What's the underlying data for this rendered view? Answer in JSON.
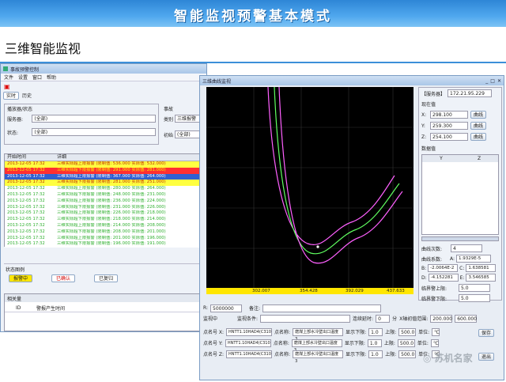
{
  "banner": {
    "title": "智能监视预警基本模式"
  },
  "slide": {
    "title": "三维智能监视"
  },
  "left_window": {
    "title": "事故预警控制",
    "menu": [
      "文件",
      "设置",
      "窗口",
      "帮助"
    ],
    "tabs": [
      "实时",
      "历史"
    ],
    "filter_section": "播放器/状态",
    "server_label": "服务器:",
    "server_value": "(全部)",
    "status_label": "状态:",
    "status_value": "(全部)",
    "right_labels": [
      "事故",
      "类别",
      "初始"
    ],
    "right_values": [
      "三维报警",
      "(全部)"
    ],
    "table": {
      "headers": [
        "开始时间",
        "详细"
      ],
      "rows": [
        {
          "time": "2013-12-05 17:32",
          "detail": "三维实际超上限报警 (限制值: 536.000  实际值: 532.000)",
          "color": "#ffff40",
          "text": "#c03000"
        },
        {
          "time": "2013-12-05 17:32",
          "detail": "三维实际超下限报警 (限制值: 291.000  实际值: 281.000)",
          "color": "#ff3030",
          "text": "#ffee00"
        },
        {
          "time": "2013-12-05 17:32",
          "detail": "三维实际超上限报警 (限制值: 367.000  实际值: 264.000)",
          "color": "#3060d0",
          "text": "#ffffff"
        },
        {
          "time": "2013-12-05 17:32",
          "detail": "三维实际超下限报警 (限制值: 281.000  实际值: 251.000)",
          "color": "#ffff40",
          "text": "#c03000"
        },
        {
          "time": "2013-12-05 17:32",
          "detail": "三维实际超上限报警 (限制值: 280.000  实际值: 264.000)",
          "color": "#ffffff",
          "text": "#30b030"
        },
        {
          "time": "2013-12-05 17:32",
          "detail": "三维实际超下限报警 (限制值: 248.000  实际值: 231.000)",
          "color": "#ffffff",
          "text": "#30b030"
        },
        {
          "time": "2013-12-05 17:32",
          "detail": "三维实际超上限报警 (限制值: 236.000  实际值: 224.000)",
          "color": "#ffffff",
          "text": "#30b030"
        },
        {
          "time": "2013-12-05 17:32",
          "detail": "三维实际超下限报警 (限制值: 231.000  实际值: 226.000)",
          "color": "#ffffff",
          "text": "#30b030"
        },
        {
          "time": "2013-12-05 17:32",
          "detail": "三维实际超上限报警 (限制值: 226.000  实际值: 218.000)",
          "color": "#ffffff",
          "text": "#30b030"
        },
        {
          "time": "2013-12-05 17:32",
          "detail": "三维实际超下限报警 (限制值: 218.000  实际值: 214.000)",
          "color": "#ffffff",
          "text": "#30b030"
        },
        {
          "time": "2013-12-05 17:32",
          "detail": "三维实际超上限报警 (限制值: 214.000  实际值: 208.000)",
          "color": "#ffffff",
          "text": "#30b030"
        },
        {
          "time": "2013-12-05 17:32",
          "detail": "三维实际超下限报警 (限制值: 208.000  实际值: 201.000)",
          "color": "#ffffff",
          "text": "#30b030"
        },
        {
          "time": "2013-12-05 17:32",
          "detail": "三维实际超上限报警 (限制值: 201.000  实际值: 196.000)",
          "color": "#ffffff",
          "text": "#30b030"
        },
        {
          "time": "2013-12-05 17:32",
          "detail": "三维实际超下限报警 (限制值: 196.000  实际值: 191.000)",
          "color": "#ffffff",
          "text": "#30b030"
        }
      ]
    },
    "state_section": "状态图例",
    "state_buttons": [
      {
        "label": "报警中",
        "bg": "#ffe600",
        "fg": "#222"
      },
      {
        "label": "已确认",
        "bg": "#ffffff",
        "fg": "#d00000"
      },
      {
        "label": "已复归",
        "bg": "#ffffff",
        "fg": "#222"
      }
    ],
    "bottom_tab": "相关量",
    "bottom_col1": "ID",
    "bottom_col2": "警报产生时间"
  },
  "right_window": {
    "title": "三维曲线监视",
    "ruler_labels": [
      "302.007",
      "354.428",
      "392.029",
      "437.633"
    ],
    "side": {
      "server_label": "【服务器】",
      "server_value": "172.21.95.229",
      "current_label": "现在值",
      "rows": [
        {
          "label": "X:",
          "value": "298.100",
          "button": "曲线"
        },
        {
          "label": "Y:",
          "value": "259.300",
          "button": "曲线"
        },
        {
          "label": "Z:",
          "value": "254.100",
          "button": "曲线"
        }
      ],
      "table_label": "数据值",
      "table_cols": [
        "Y",
        "Z"
      ],
      "fit_rows": [
        {
          "label": "曲线次数:",
          "value": "4"
        },
        {
          "label": "曲线系数:",
          "a": "A:",
          "av": "1.9329E-5"
        },
        {
          "b": "B:",
          "bv": "-2.0064E-2",
          "c": "C:",
          "cv": "1.638581"
        },
        {
          "d": "D:",
          "dv": "-4.152281",
          "e": "E:",
          "ev": "3.546585"
        }
      ],
      "upper_label": "临界警上限:",
      "upper_value": "5.0",
      "lower_label": "临界警下限:",
      "lower_value": "5.0"
    },
    "bottom": {
      "r_label": "R:",
      "r_value": "5000000",
      "note_label": "备注:",
      "monitor_label": "监视中",
      "cond_label": "监视条件:",
      "delay_label": "连续延时:",
      "delay_value": "0",
      "unit_s": "分",
      "xrange_label": "X轴初值范围:",
      "xrange_from": "200.000",
      "xrange_to": "600.000",
      "point_rows": [
        {
          "p1": "点名号 X:",
          "v1": "HNTT1.10HAD4(C310",
          "p2": "点名称:",
          "v2": "磨煤上部水冷壁出口温度3",
          "p3": "显示下限:",
          "v3": "1.0",
          "p4": "上限:",
          "v4": "500.0",
          "p5": "单位:",
          "v5": "℃"
        },
        {
          "p1": "点名号 Y:",
          "v1": "HNTT1.10HAD4(C310",
          "p2": "点名称:",
          "v2": "磨煤上部水冷壁出口温度3",
          "p3": "显示下限:",
          "v3": "1.0",
          "p4": "上限:",
          "v4": "500.0",
          "p5": "单位:",
          "v5": "℃"
        },
        {
          "p1": "点名号 Z:",
          "v1": "HNTT1.10HAD4(C310",
          "p2": "点名称:",
          "v2": "磨煤上部水冷壁出口温度3",
          "p3": "显示下限:",
          "v3": "1.0",
          "p4": "上限:",
          "v4": "500.0",
          "p5": "单位:",
          "v5": "℃"
        }
      ],
      "save_button": "保存",
      "exit_button": "退出"
    }
  },
  "watermark": "苏机名家",
  "colors": {
    "banner": "#3b95e0",
    "plot_bg": "#000000",
    "curve_outer": "#ff60ff",
    "curve_inner": "#60ff60",
    "grid": "#3a3a3a"
  }
}
